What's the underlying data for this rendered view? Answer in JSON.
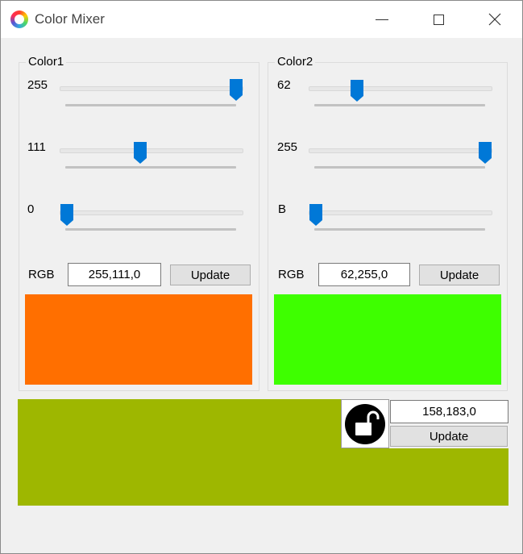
{
  "window": {
    "title": "Color Mixer"
  },
  "color1": {
    "group_title": "Color1",
    "sliders": [
      {
        "label": "255",
        "value": 255,
        "max": 255
      },
      {
        "label": "111",
        "value": 111,
        "max": 255
      },
      {
        "label": "0",
        "value": 0,
        "max": 255
      }
    ],
    "rgb_label": "RGB",
    "rgb_value": "255,111,0",
    "update_label": "Update",
    "swatch_color": "#ff6f00"
  },
  "color2": {
    "group_title": "Color2",
    "sliders": [
      {
        "label": "62",
        "value": 62,
        "max": 255
      },
      {
        "label": "255",
        "value": 255,
        "max": 255
      },
      {
        "label": "B",
        "value": 0,
        "max": 255
      }
    ],
    "rgb_label": "RGB",
    "rgb_value": "62,255,0",
    "update_label": "Update",
    "swatch_color": "#3eff00"
  },
  "mix": {
    "rgb_value": "158,183,0",
    "update_label": "Update",
    "color": "#9eb700",
    "lock_icon": "unlocked-padlock-icon"
  },
  "colors": {
    "accent": "#0078d7",
    "background": "#f0f0f0"
  }
}
